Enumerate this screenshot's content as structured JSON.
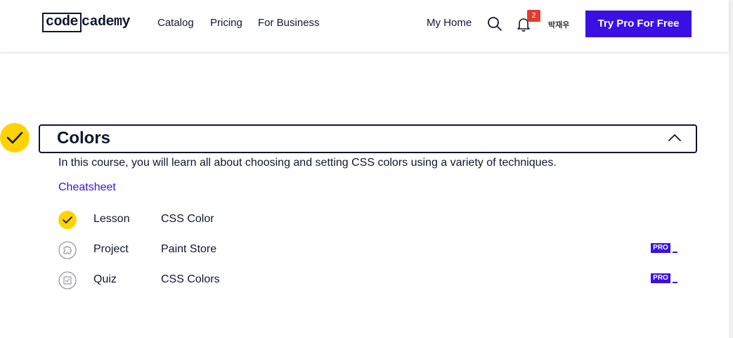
{
  "header": {
    "logo_left": "code",
    "logo_right": "cademy",
    "nav": [
      "Catalog",
      "Pricing",
      "For Business"
    ],
    "my_home": "My Home",
    "notification_count": "2",
    "username": "박재우",
    "cta": "Try Pro For Free"
  },
  "page": {
    "partial_text": "·  ,  ·  ·  ,  ·  "
  },
  "module": {
    "title": "Colors",
    "description": "In this course, you will learn all about choosing and setting CSS colors using a variety of techniques.",
    "cheatsheet_label": "Cheatsheet",
    "items": [
      {
        "type": "Lesson",
        "name": "CSS Color",
        "icon": "completed-check-icon",
        "pro": ""
      },
      {
        "type": "Project",
        "name": "Paint Store",
        "icon": "project-puzzle-icon",
        "pro": "PRO"
      },
      {
        "type": "Quiz",
        "name": "CSS Colors",
        "icon": "quiz-icon",
        "pro": "PRO"
      }
    ]
  },
  "colors": {
    "brand": "#3a10e5",
    "check": "#ffd300",
    "badge": "#e03c31",
    "text": "#10162f"
  }
}
